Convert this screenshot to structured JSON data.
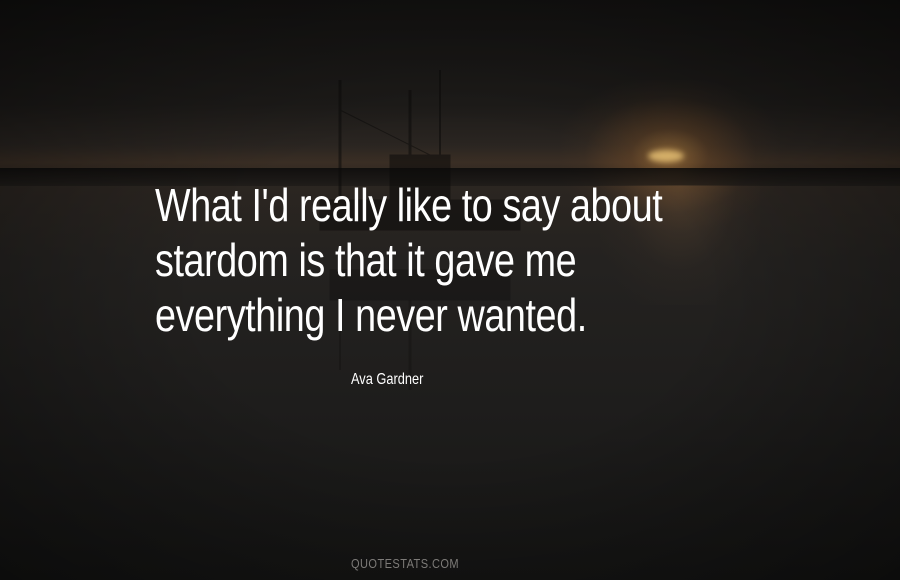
{
  "quote": {
    "lines": [
      "What I'd really like to say about",
      "stardom is that it gave me",
      "everything I never wanted."
    ]
  },
  "author": "Ava Gardner",
  "watermark": "QUOTESTATS.COM",
  "colors": {
    "text": "#ffffff",
    "watermark": "#7d7b78",
    "sun": "#d69646"
  }
}
